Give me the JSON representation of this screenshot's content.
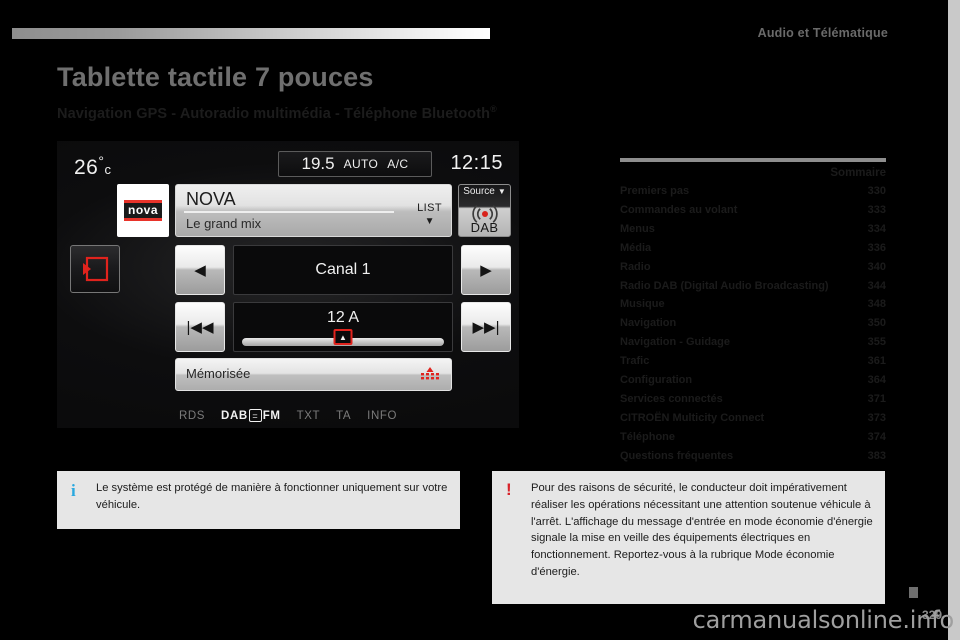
{
  "header": {
    "chapter": "Audio et Télématique"
  },
  "title": "Tablette tactile 7 pouces",
  "subtitle": "Navigation GPS - Autoradio multimédia - Téléphone Bluetooth",
  "subtitle_sup": "®",
  "infotainment": {
    "temperature": "26",
    "degree_symbol": "°",
    "temperature_unit": "c",
    "ac_value": "19.5",
    "ac_auto": "AUTO",
    "ac_label": "A/C",
    "clock": "12:15",
    "station_logo": "nova",
    "station_name": "NOVA",
    "station_subtitle": "Le grand mix",
    "list_label": "LIST",
    "list_caret": "▼",
    "source_label": "Source",
    "source_caret": "▼",
    "source_mode": "DAB",
    "prev_arrow": "◀",
    "next_arrow": "▶",
    "seek_prev": "|◀◀",
    "seek_next": "▶▶|",
    "channel": "Canal 1",
    "frequency": "12 A",
    "thumb_glyph": "▲",
    "memorised_label": "Mémorisée",
    "flags": [
      "RDS",
      "DAB",
      "FM",
      "TXT",
      "TA",
      "INFO"
    ],
    "dab_badge_glyph": "="
  },
  "summary": {
    "heading": "Sommaire",
    "entries": [
      {
        "label": "Premiers pas",
        "page": "330"
      },
      {
        "label": "Commandes au volant",
        "page": "333"
      },
      {
        "label": "Menus",
        "page": "334"
      },
      {
        "label": "Média",
        "page": "336"
      },
      {
        "label": "Radio",
        "page": "340"
      },
      {
        "label": "Radio DAB (Digital Audio Broadcasting)",
        "page": "344"
      },
      {
        "label": "Musique",
        "page": "348"
      },
      {
        "label": "Navigation",
        "page": "350"
      },
      {
        "label": "Navigation - Guidage",
        "page": "355"
      },
      {
        "label": "Trafic",
        "page": "361"
      },
      {
        "label": "Configuration",
        "page": "364"
      },
      {
        "label": "Services connectés",
        "page": "371"
      },
      {
        "label": "CITROËN Multicity Connect",
        "page": "373"
      },
      {
        "label": "Téléphone",
        "page": "374"
      },
      {
        "label": "Questions fréquentes",
        "page": "383"
      }
    ]
  },
  "note": {
    "icon": "i",
    "text": "Le système est protégé de manière à fonctionner uniquement sur votre véhicule."
  },
  "warning": {
    "icon": "!",
    "text": "Pour des raisons de sécurité, le conducteur doit impérativement réaliser les opérations nécessitant une attention soutenue véhicule à l'arrêt. L'affichage du message d'entrée en mode économie d'énergie signale la mise en veille des équipements électriques en fonctionnement. Reportez-vous à la rubrique Mode économie d'énergie."
  },
  "footer": {
    "page_number": "329",
    "watermark": "carmanualsonline.info"
  }
}
